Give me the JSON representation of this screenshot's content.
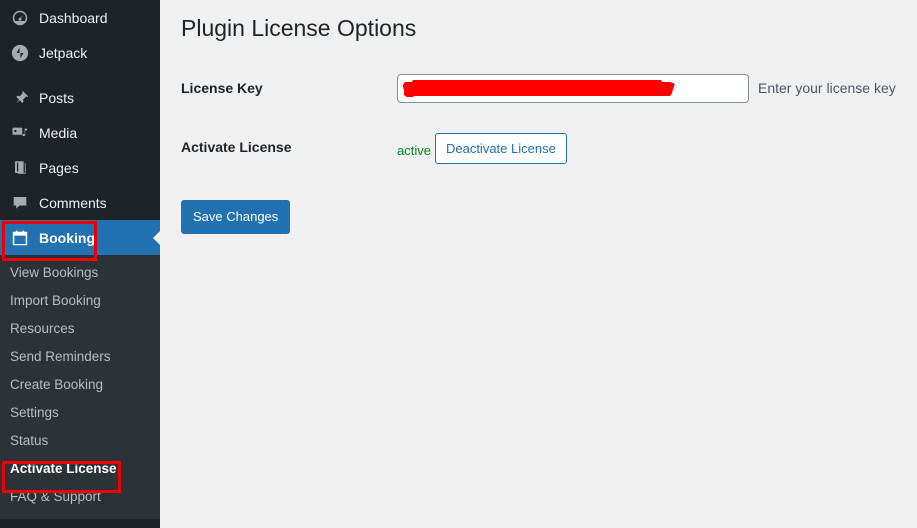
{
  "sidebar": {
    "items": [
      {
        "label": "Dashboard",
        "icon": "dashboard-icon",
        "current": false
      },
      {
        "label": "Jetpack",
        "icon": "jetpack-icon",
        "current": false
      },
      {
        "label": "Posts",
        "icon": "posts-pin-icon",
        "current": false
      },
      {
        "label": "Media",
        "icon": "media-icon",
        "current": false
      },
      {
        "label": "Pages",
        "icon": "pages-icon",
        "current": false
      },
      {
        "label": "Comments",
        "icon": "comments-icon",
        "current": false
      },
      {
        "label": "Booking",
        "icon": "calendar-icon",
        "current": true
      }
    ],
    "submenu": [
      {
        "label": "View Bookings",
        "current": false
      },
      {
        "label": "Import Booking",
        "current": false
      },
      {
        "label": "Resources",
        "current": false
      },
      {
        "label": "Send Reminders",
        "current": false
      },
      {
        "label": "Create Booking",
        "current": false
      },
      {
        "label": "Settings",
        "current": false
      },
      {
        "label": "Status",
        "current": false
      },
      {
        "label": "Activate License",
        "current": true
      },
      {
        "label": "FAQ & Support",
        "current": false
      }
    ]
  },
  "main": {
    "page_title": "Plugin License Options",
    "license_key": {
      "label": "License Key",
      "value": "",
      "placeholder": "",
      "description": "Enter your license key",
      "redacted": true
    },
    "activate_license": {
      "label": "Activate License",
      "status": "active",
      "button_label": "Deactivate License"
    },
    "save_label": "Save Changes"
  },
  "colors": {
    "sidebar_bg": "#1d2327",
    "submenu_bg": "#2c3338",
    "accent_blue": "#2271b1",
    "status_green": "#008a20",
    "annotation_red": "#ee0000",
    "content_bg": "#f0f0f1"
  }
}
